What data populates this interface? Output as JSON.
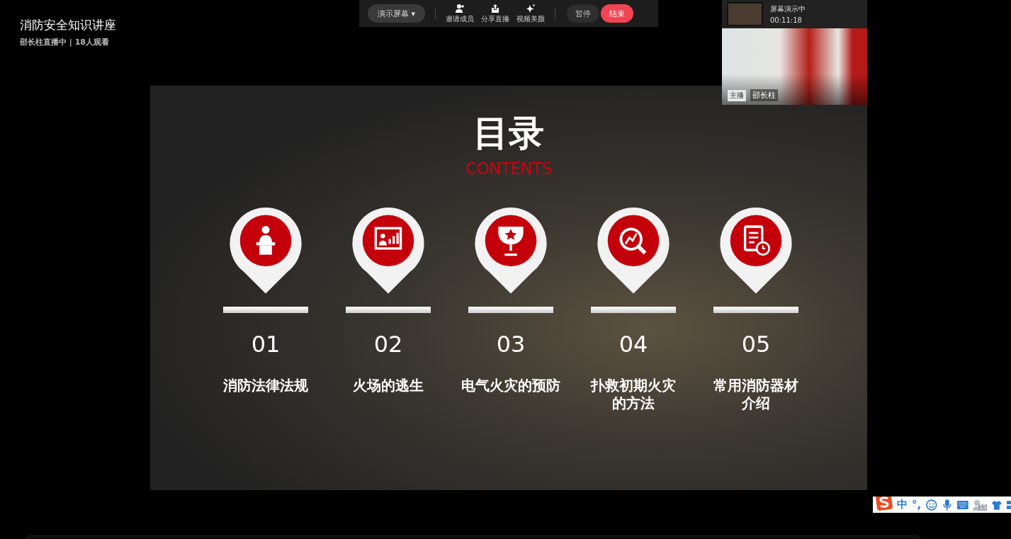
{
  "stream": {
    "title": "消防安全知识讲座",
    "subtitle": "邵长柱直播中 | 18人观看"
  },
  "toolbar": {
    "screen_menu": "演示屏幕 ▾",
    "tools": [
      {
        "label": "邀请成员"
      },
      {
        "label": "分享直播"
      },
      {
        "label": "视频美颜"
      }
    ],
    "pause": "暂停",
    "end": "结束"
  },
  "preview": {
    "status": "屏幕演示中",
    "elapsed": "00:11:18",
    "host_tag": "主播",
    "host_name": "邵长柱"
  },
  "slide": {
    "title": "目录",
    "subtitle": "CONTENTS",
    "items": [
      {
        "number": "01",
        "label": [
          "消防法律法规"
        ]
      },
      {
        "number": "02",
        "label": [
          "火场的逃生"
        ]
      },
      {
        "number": "03",
        "label": [
          "电气火灾的预防"
        ]
      },
      {
        "number": "04",
        "label": [
          "扑救初期火灾",
          "的方法"
        ]
      },
      {
        "number": "05",
        "label": [
          "常用消防器材",
          "介绍"
        ]
      }
    ]
  },
  "ime": {
    "mode": "中",
    "punctuation": "°,",
    "badge": "15"
  }
}
